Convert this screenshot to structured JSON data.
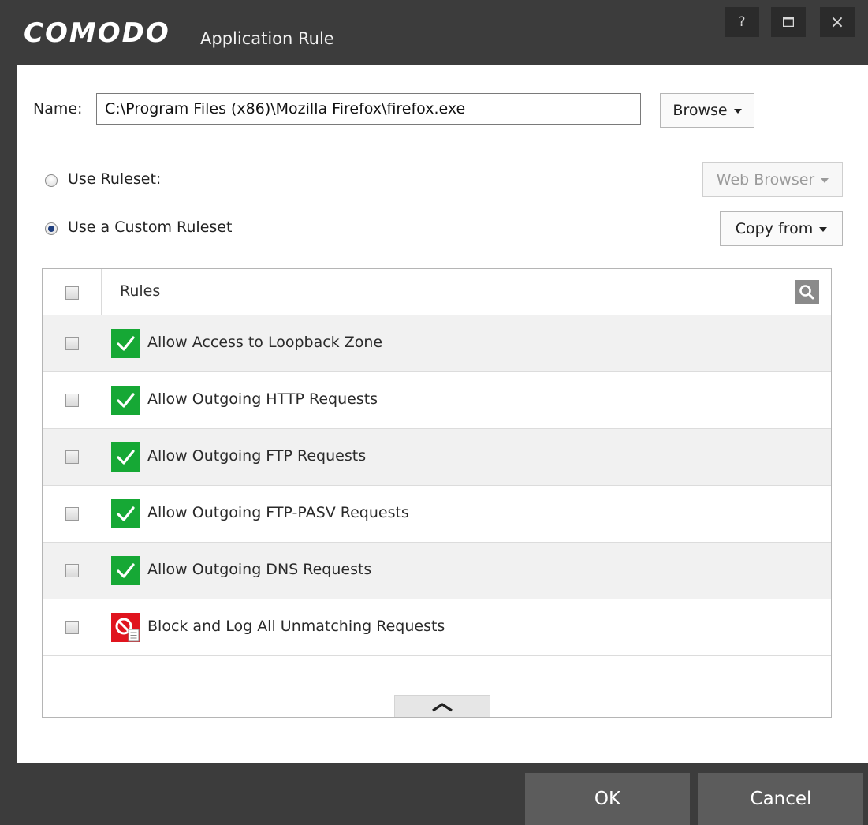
{
  "titlebar": {
    "brand": "COMODO",
    "title": "Application Rule",
    "help_icon": "?",
    "maximize_icon": "maximize-icon",
    "close_icon": "×"
  },
  "form": {
    "name_label": "Name:",
    "name_value": "C:\\Program Files (x86)\\Mozilla Firefox\\firefox.exe",
    "browse_label": "Browse",
    "use_ruleset_label": "Use Ruleset:",
    "ruleset_value": "Web Browser",
    "use_custom_label": "Use a Custom Ruleset",
    "copy_from_label": "Copy from",
    "selected_option": "custom"
  },
  "table": {
    "header": "Rules",
    "rows": [
      {
        "label": "Allow Access to Loopback Zone",
        "icon": "allow-check-icon"
      },
      {
        "label": "Allow Outgoing HTTP Requests",
        "icon": "allow-check-icon"
      },
      {
        "label": "Allow Outgoing FTP Requests",
        "icon": "allow-check-icon"
      },
      {
        "label": "Allow Outgoing FTP-PASV Requests",
        "icon": "allow-check-icon"
      },
      {
        "label": "Allow Outgoing DNS Requests",
        "icon": "allow-check-icon"
      },
      {
        "label": "Block and Log All Unmatching Requests",
        "icon": "block-log-icon"
      }
    ]
  },
  "footer": {
    "ok_label": "OK",
    "cancel_label": "Cancel"
  },
  "colors": {
    "chrome": "#3c3c3c",
    "allow": "#16a835",
    "block": "#e0141e",
    "button": "#5c5c5c"
  }
}
